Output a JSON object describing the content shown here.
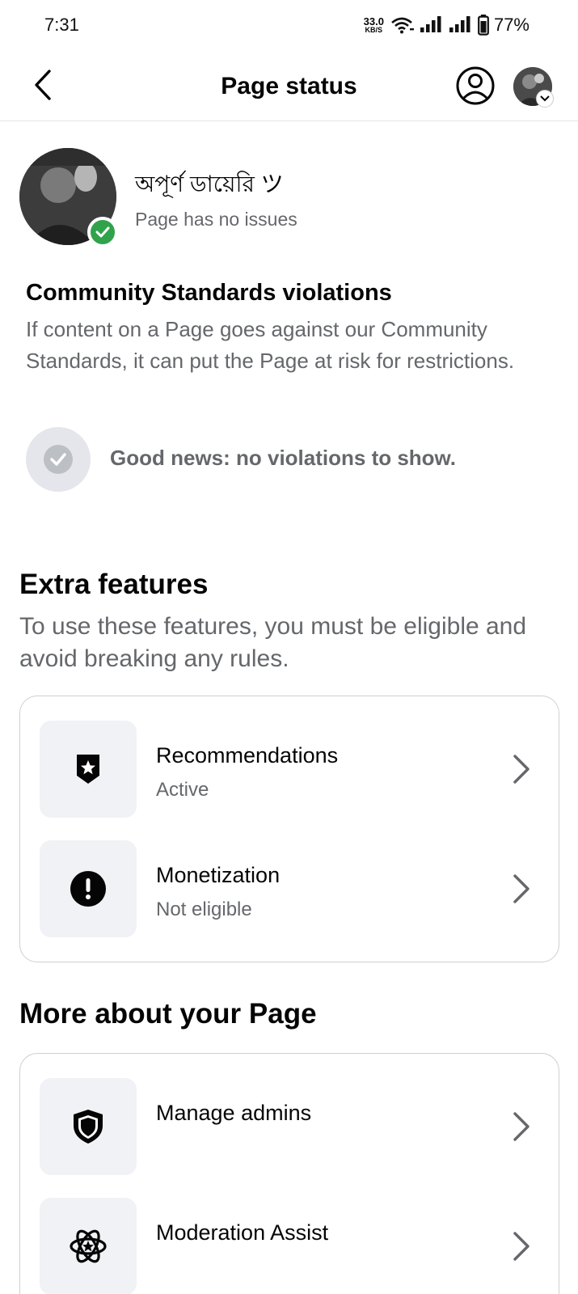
{
  "status_bar": {
    "time": "7:31",
    "net_speed_value": "33.0",
    "net_speed_unit": "KB/S",
    "battery_percent": "77%"
  },
  "header": {
    "title": "Page status"
  },
  "page": {
    "name": "অপূর্ণ ডায়েরি ツ",
    "status": "Page has no issues"
  },
  "community_standards": {
    "title": "Community Standards violations",
    "description": "If content on a Page goes against our Community Standards, it can put the Page at risk for restrictions.",
    "good_news": "Good news: no violations to show."
  },
  "extra_features": {
    "title": "Extra features",
    "description": "To use these features, you must be eligible and avoid breaking any rules.",
    "items": [
      {
        "title": "Recommendations",
        "subtitle": "Active",
        "icon": "badge-star-icon"
      },
      {
        "title": "Monetization",
        "subtitle": "Not eligible",
        "icon": "exclamation-icon"
      }
    ]
  },
  "more_about": {
    "title": "More about your Page",
    "items": [
      {
        "title": "Manage admins",
        "icon": "shield-icon"
      },
      {
        "title": "Moderation Assist",
        "icon": "atom-star-icon"
      }
    ]
  },
  "colors": {
    "accent_green": "#31a24c",
    "secondary_text": "#65676b",
    "icon_bg": "#f0f2f5"
  }
}
